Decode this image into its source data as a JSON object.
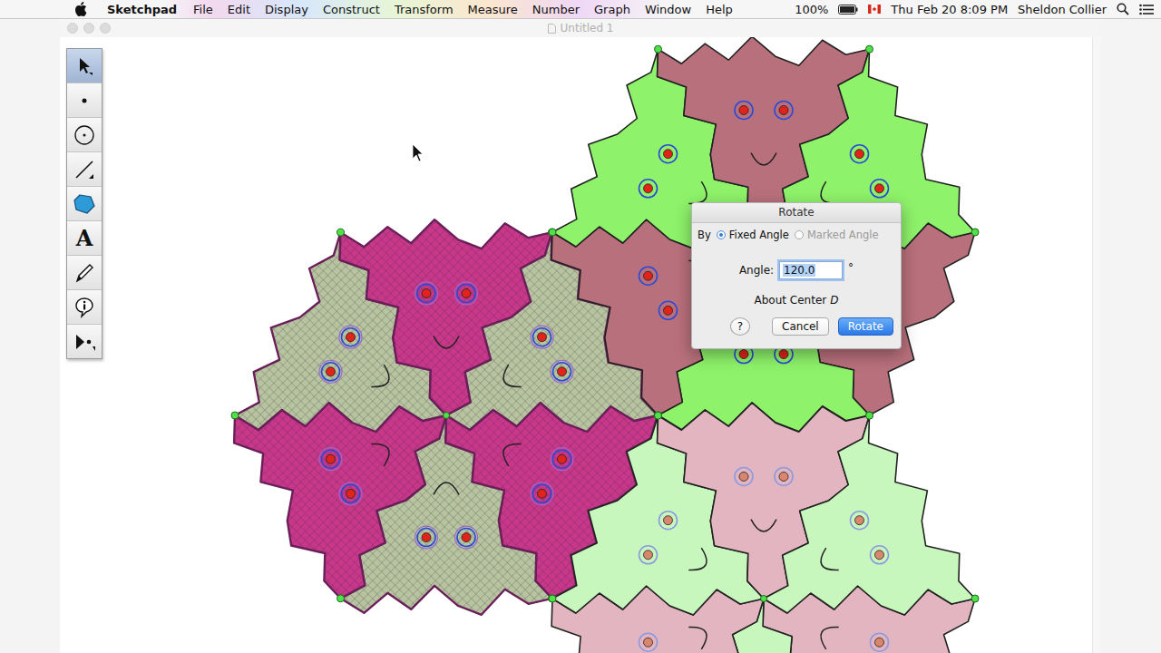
{
  "menubar": {
    "app": "Sketchpad",
    "menus": [
      "File",
      "Edit",
      "Display",
      "Construct",
      "Transform",
      "Measure",
      "Number",
      "Graph",
      "Window",
      "Help"
    ],
    "battery": "100%",
    "clock": "Thu Feb 20  8:09 PM",
    "user": "Sheldon Collier"
  },
  "window": {
    "title": "Untitled 1"
  },
  "toolbox": [
    {
      "kind": "arrow",
      "label": "",
      "selected": true
    },
    {
      "kind": "point",
      "label": "",
      "selected": false
    },
    {
      "kind": "compass",
      "label": "",
      "selected": false
    },
    {
      "kind": "line",
      "label": "",
      "selected": false
    },
    {
      "kind": "polygon",
      "label": "",
      "selected": false
    },
    {
      "kind": "text",
      "label": "A",
      "selected": false
    },
    {
      "kind": "marker",
      "label": "",
      "selected": false
    },
    {
      "kind": "info",
      "label": "",
      "selected": false
    },
    {
      "kind": "custom",
      "label": "",
      "selected": false
    }
  ],
  "canvas": {
    "clusters": [
      {
        "tile_colors": [
          "#c8378a",
          "#b7c4a0"
        ],
        "selected": true
      },
      {
        "tile_colors": [
          "#b8707c",
          "#8ef26a"
        ],
        "selected": false
      },
      {
        "tile_colors": [
          "#e3b5c1",
          "#c8f7bd"
        ],
        "selected": false
      }
    ]
  },
  "dialog": {
    "title": "Rotate",
    "by_label": "By",
    "options": [
      {
        "label": "Fixed Angle",
        "selected": true,
        "disabled": false
      },
      {
        "label": "Marked Angle",
        "selected": false,
        "disabled": true
      }
    ],
    "angle_label": "Angle:",
    "angle_value": "120.0",
    "unit": "°",
    "center_label": "About Center",
    "center_point": "D",
    "buttons": [
      {
        "label": "?",
        "default": false
      },
      {
        "label": "Cancel",
        "default": false
      },
      {
        "label": "Rotate",
        "default": true
      }
    ]
  }
}
